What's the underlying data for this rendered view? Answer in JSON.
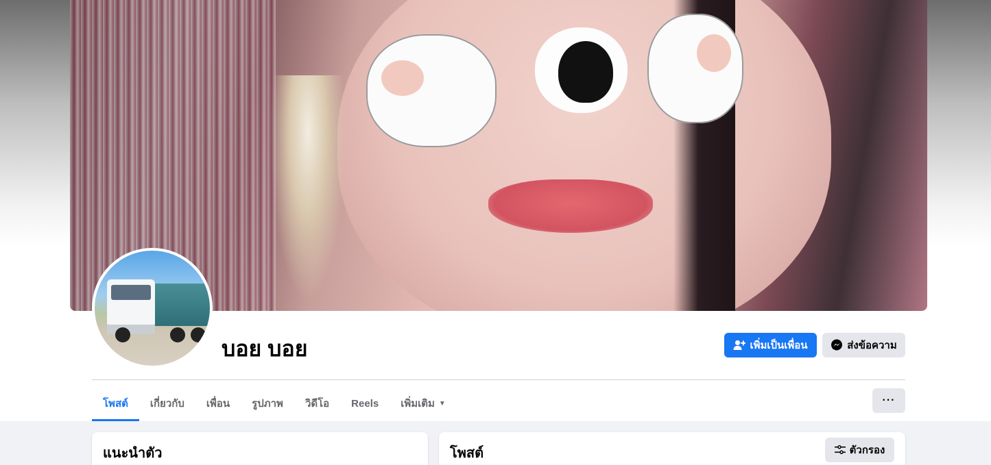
{
  "profile": {
    "name": "บอย บอย"
  },
  "actions": {
    "add_friend_label": "เพิ่มเป็นเพื่อน",
    "message_label": "ส่งข้อความ",
    "more_label": "···"
  },
  "tabs": [
    {
      "label": "โพสต์",
      "active": true
    },
    {
      "label": "เกี่ยวกับ",
      "active": false
    },
    {
      "label": "เพื่อน",
      "active": false
    },
    {
      "label": "รูปภาพ",
      "active": false
    },
    {
      "label": "วิดีโอ",
      "active": false
    },
    {
      "label": "Reels",
      "active": false
    },
    {
      "label": "เพิ่มเติม",
      "active": false
    }
  ],
  "cards": {
    "intro_title": "แนะนำตัว",
    "posts_title": "โพสต์",
    "filter_label": "ตัวกรอง"
  },
  "icons": {
    "add_friend": "person-plus-icon",
    "messenger": "messenger-icon",
    "more_tabs": "caret-down-icon",
    "filter": "sliders-icon"
  },
  "colors": {
    "accent": "#1877f2",
    "button_secondary": "#e4e6eb",
    "text_secondary": "#65676b",
    "page_background": "#f0f2f5"
  }
}
